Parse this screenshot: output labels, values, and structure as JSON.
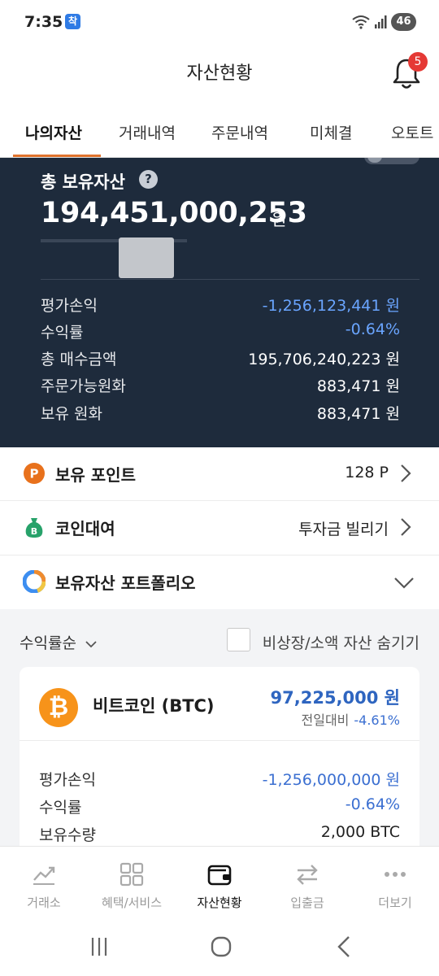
{
  "status_bar": {
    "time": "7:35",
    "app_badge": "착",
    "battery": "46"
  },
  "header": {
    "title": "자산현황",
    "notification_count": "5"
  },
  "tabs": [
    {
      "label": "나의자산",
      "active": true
    },
    {
      "label": "거래내역"
    },
    {
      "label": "주문내역"
    },
    {
      "label": "미체결"
    },
    {
      "label": "오토트"
    }
  ],
  "summary": {
    "total_label": "총 보유자산",
    "help": "?",
    "total_value": "194,451,000,253",
    "total_unit": "원",
    "rows": [
      {
        "label": "평가손익",
        "value": "-1,256,123,441 원"
      },
      {
        "label": "수익률",
        "value": "-0.64%"
      },
      {
        "label": "총 매수금액",
        "value": "195,706,240,223 원"
      },
      {
        "label": "주문가능원화",
        "value": "883,471 원"
      },
      {
        "label": "보유 원화",
        "value": "883,471 원"
      }
    ]
  },
  "points": {
    "icon_letter": "P",
    "title": "보유 포인트",
    "value": "128 P"
  },
  "coin_loan": {
    "title": "코인대여",
    "link": "투자금 빌리기"
  },
  "portfolio": {
    "title": "보유자산 포트폴리오"
  },
  "filter": {
    "sort_label": "수익률순",
    "hide_label": "비상장/소액 자산 숨기기"
  },
  "coin": {
    "symbol": "₿",
    "name": "비트코인 (BTC)",
    "price": "97,225,000 원",
    "change_label": "전일대비",
    "change": "-4.61%",
    "rows": [
      {
        "label": "평가손익",
        "value": "-1,256,000,000 원"
      },
      {
        "label": "수익률",
        "value": "-0.64%"
      },
      {
        "label": "보유수량",
        "value": "2,000 BTC"
      }
    ]
  },
  "bottom_nav": [
    {
      "label": "거래소",
      "icon": "chart-line-icon"
    },
    {
      "label": "혜택/서비스",
      "icon": "grid-icon"
    },
    {
      "label": "자산현황",
      "icon": "wallet-icon",
      "active": true
    },
    {
      "label": "입출금",
      "icon": "transfer-arrows-icon"
    },
    {
      "label": "더보기",
      "icon": "more-dots-icon"
    }
  ],
  "colors": {
    "panel": "#1e2b3c",
    "accent": "#e0732c",
    "negative": "#3b6fd1",
    "badge": "#e53935"
  }
}
